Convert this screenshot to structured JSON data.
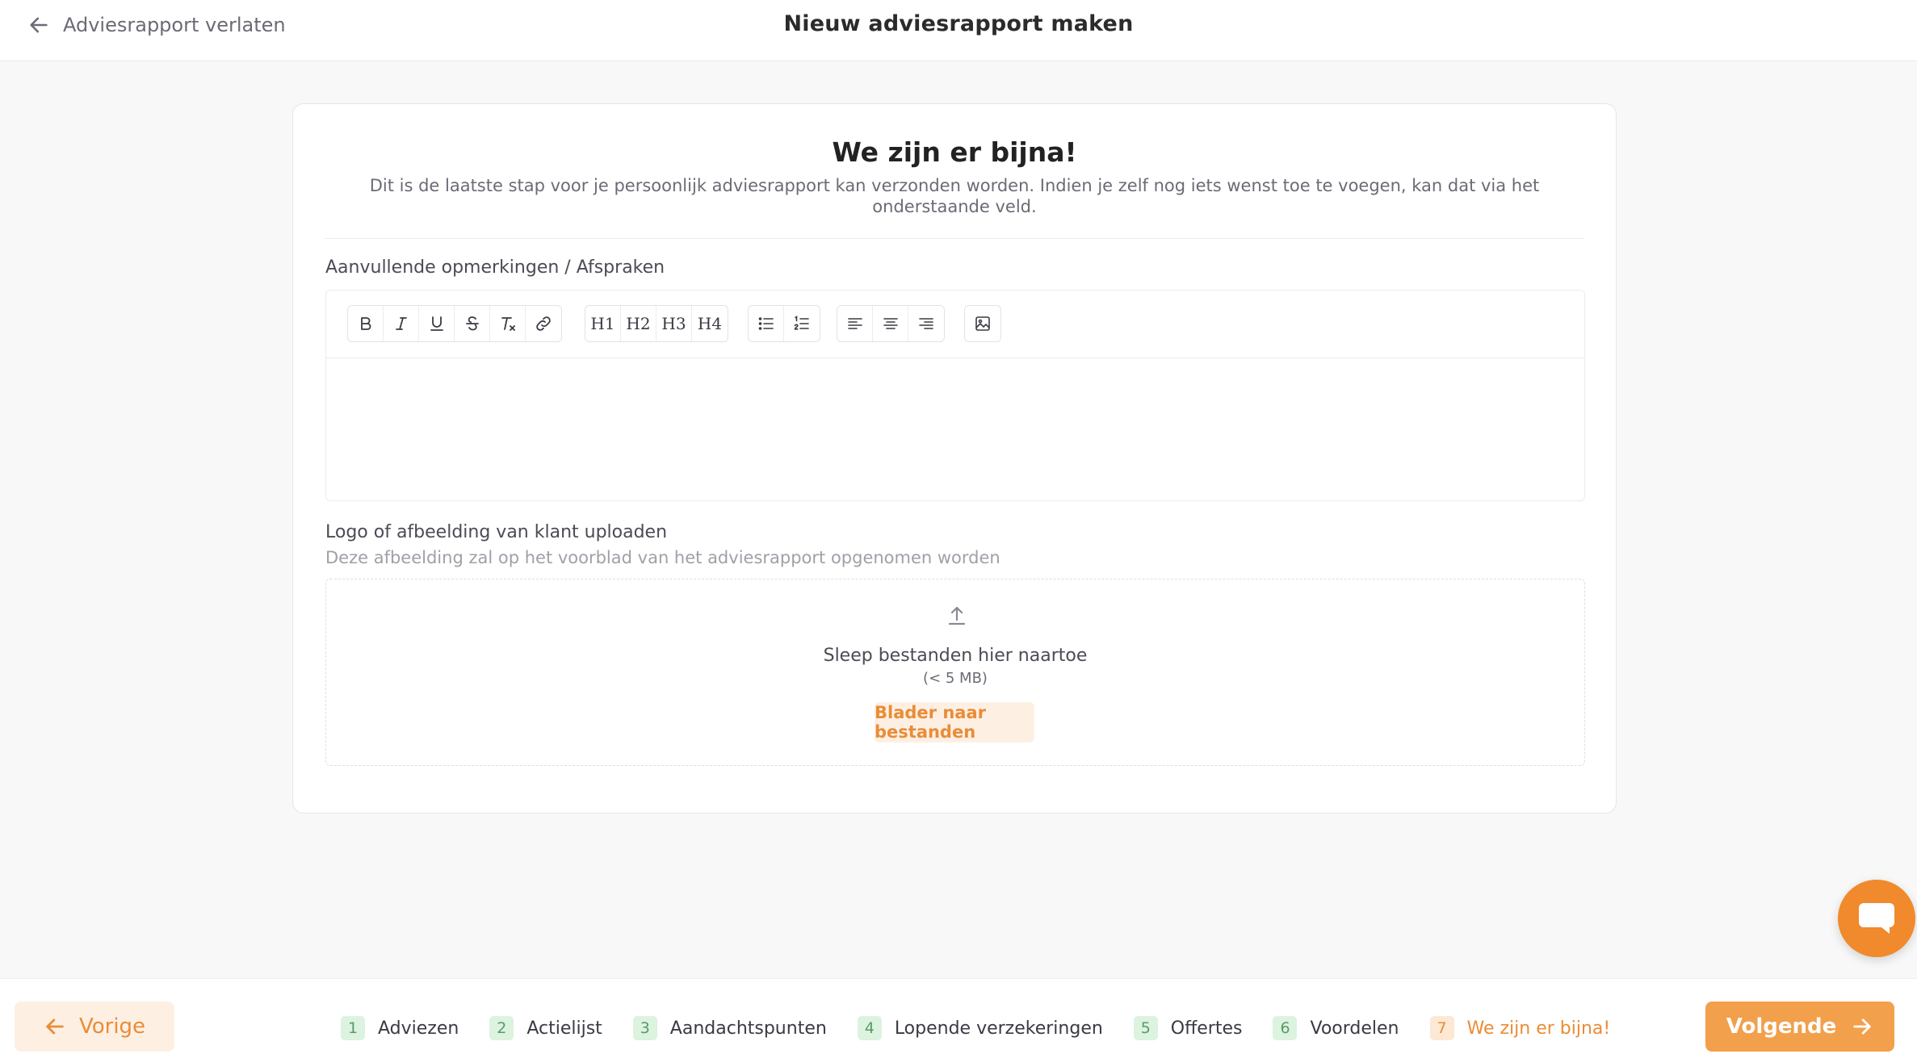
{
  "header": {
    "back_label": "Adviesrapport verlaten",
    "title": "Nieuw adviesrapport maken"
  },
  "card": {
    "heading": "We zijn er bijna!",
    "subtitle": "Dit is de laatste stap voor je persoonlijk adviesrapport kan verzonden worden. Indien je zelf nog iets wenst toe te voegen, kan dat via het onderstaande veld."
  },
  "editor": {
    "label": "Aanvullende opmerkingen / Afspraken",
    "value": "",
    "toolbar": {
      "format": [
        "bold-icon",
        "italic-icon",
        "underline-icon",
        "strikethrough-icon",
        "clear-format-icon",
        "link-icon"
      ],
      "headings": [
        "H1",
        "H2",
        "H3",
        "H4"
      ],
      "lists": [
        "bullet-list-icon",
        "ordered-list-icon"
      ],
      "align": [
        "align-left-icon",
        "align-center-icon",
        "align-right-icon"
      ],
      "media": [
        "image-icon"
      ]
    }
  },
  "upload": {
    "label": "Logo of afbeelding van klant uploaden",
    "help": "Deze afbeelding zal op het voorblad van het adviesrapport opgenomen worden",
    "drop_text": "Sleep bestanden hier naartoe",
    "limit": "(< 5 MB)",
    "browse_label": "Blader naar bestanden"
  },
  "footer": {
    "prev_label": "Vorige",
    "next_label": "Volgende",
    "steps": [
      {
        "num": "1",
        "label": "Adviezen",
        "state": "done"
      },
      {
        "num": "2",
        "label": "Actielijst",
        "state": "done"
      },
      {
        "num": "3",
        "label": "Aandachtspunten",
        "state": "done"
      },
      {
        "num": "4",
        "label": "Lopende verzekeringen",
        "state": "done"
      },
      {
        "num": "5",
        "label": "Offertes",
        "state": "done"
      },
      {
        "num": "6",
        "label": "Voordelen",
        "state": "done"
      },
      {
        "num": "7",
        "label": "We zijn er bijna!",
        "state": "active"
      }
    ]
  },
  "colors": {
    "accent": "#ea8c37",
    "accent_soft": "#fdf0e3",
    "done_step": "#dcf3df",
    "chat": "#f08a2d"
  },
  "chat_icon": "chat-bubble-icon"
}
